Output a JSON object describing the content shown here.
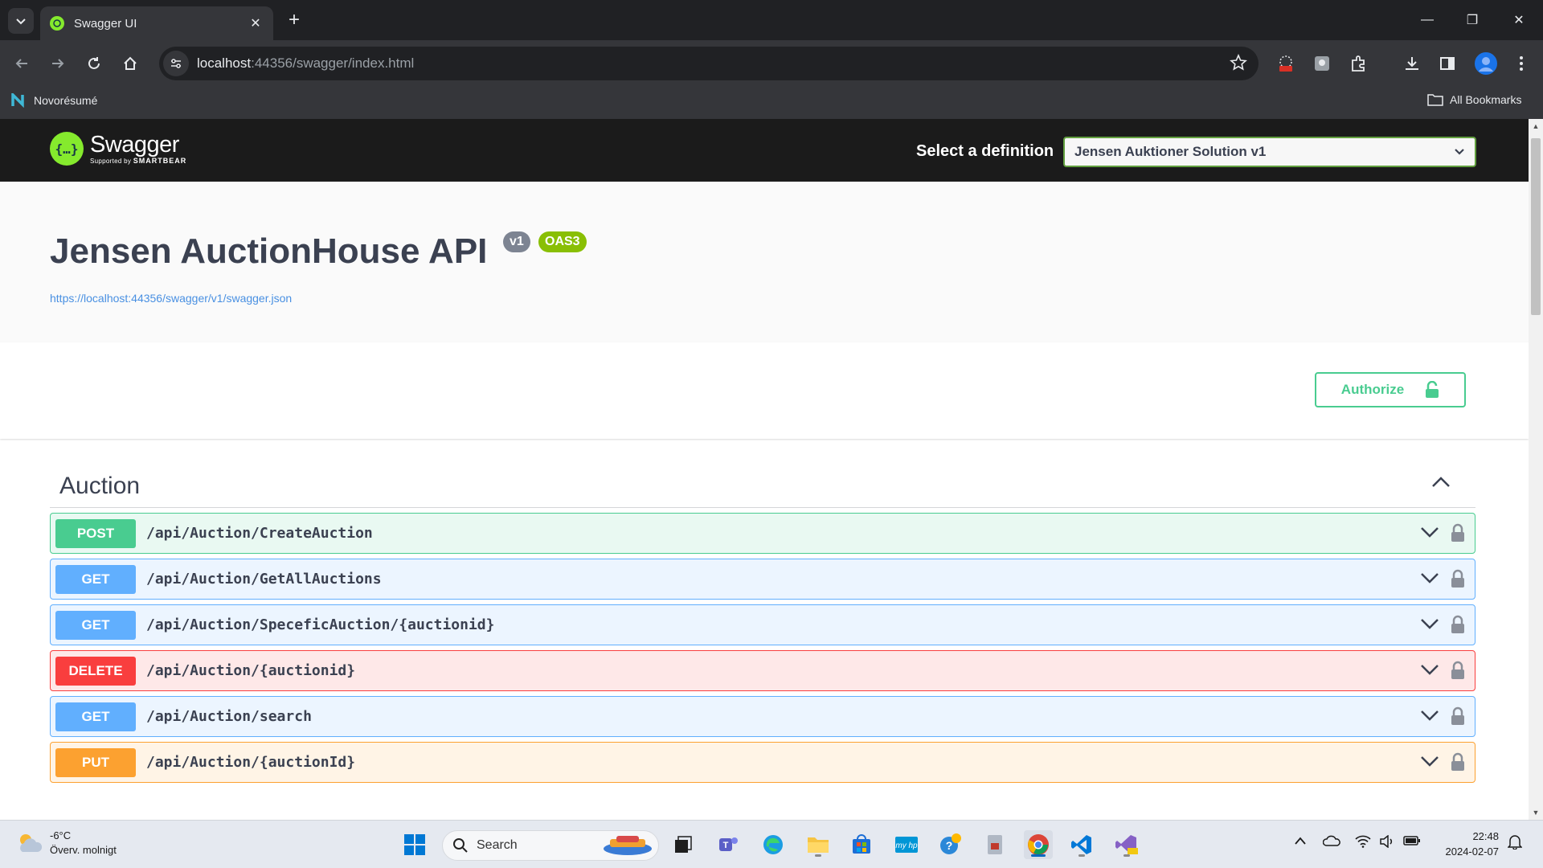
{
  "browser": {
    "tab_title": "Swagger UI",
    "url_host": "localhost",
    "url_rest": ":44356/swagger/index.html",
    "bookmarks": [
      {
        "label": "Novorésumé"
      },
      {
        "label": "All Bookmarks"
      }
    ]
  },
  "swagger": {
    "brand": "Swagger",
    "brand_sub_prefix": "Supported by",
    "brand_sub": "SMARTBEAR",
    "select_label": "Select a definition",
    "selected_definition": "Jensen Auktioner Solution v1",
    "api_title": "Jensen AuctionHouse API",
    "version_badge": "v1",
    "oas_badge": "OAS3",
    "spec_url": "https://localhost:44356/swagger/v1/swagger.json",
    "authorize_label": "Authorize",
    "tag": "Auction",
    "operations": [
      {
        "method": "POST",
        "path": "/api/Auction/CreateAuction"
      },
      {
        "method": "GET",
        "path": "/api/Auction/GetAllAuctions"
      },
      {
        "method": "GET",
        "path": "/api/Auction/SpeceficAuction/{auctionid}"
      },
      {
        "method": "DELETE",
        "path": "/api/Auction/{auctionid}"
      },
      {
        "method": "GET",
        "path": "/api/Auction/search"
      },
      {
        "method": "PUT",
        "path": "/api/Auction/{auctionId}"
      }
    ]
  },
  "taskbar": {
    "weather_temp": "-6°C",
    "weather_desc": "Överv. molnigt",
    "search_label": "Search",
    "time": "22:48",
    "date": "2024-02-07"
  },
  "colors": {
    "swagger_green": "#85ea2d",
    "post": "#49cc90",
    "get": "#61affe",
    "delete": "#f93e3e",
    "put": "#fca130"
  }
}
